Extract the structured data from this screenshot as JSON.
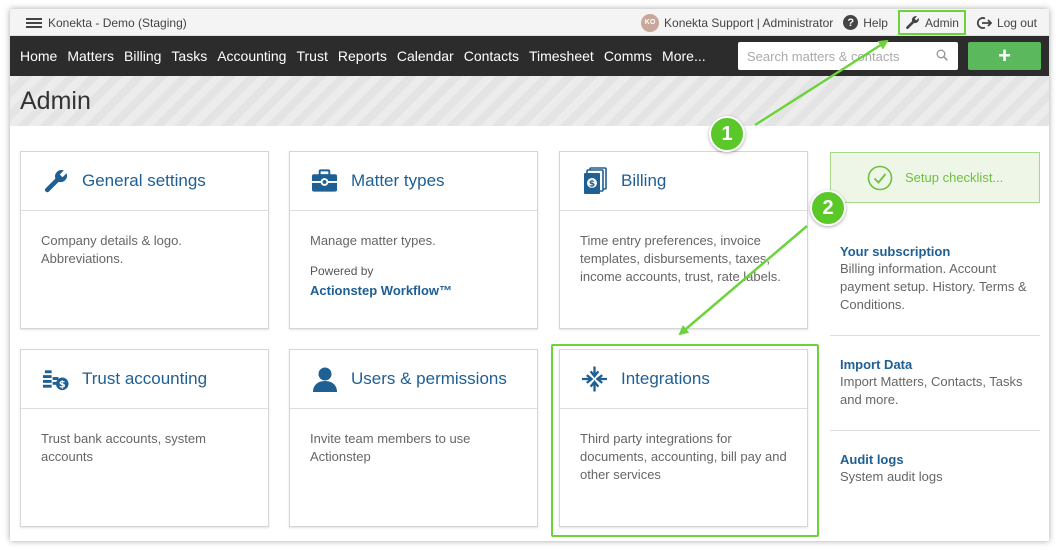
{
  "topbar": {
    "app_title": "Konekta - Demo (Staging)",
    "avatar_initials": "KO",
    "user": "Konekta Support | Administrator",
    "help": "Help",
    "admin": "Admin",
    "logout": "Log out"
  },
  "nav": {
    "items": [
      "Home",
      "Matters",
      "Billing",
      "Tasks",
      "Accounting",
      "Trust",
      "Reports",
      "Calendar",
      "Contacts",
      "Timesheet",
      "Comms",
      "More..."
    ],
    "search_placeholder": "Search matters & contacts",
    "add_label": "+"
  },
  "page": {
    "title": "Admin"
  },
  "cards": [
    {
      "title": "General settings",
      "desc": "Company details & logo. Abbreviations.",
      "icon": "wrench-icon"
    },
    {
      "title": "Matter types",
      "desc": "Manage matter types.",
      "powered_by": "Powered by",
      "powered_link": "Actionstep Workflow™",
      "icon": "toolbox-icon"
    },
    {
      "title": "Billing",
      "desc": "Time entry preferences, invoice templates, disbursements, taxes, income accounts, trust, rate labels.",
      "icon": "invoice-icon"
    },
    {
      "title": "Trust accounting",
      "desc": "Trust bank accounts, system accounts",
      "icon": "coins-icon"
    },
    {
      "title": "Users & permissions",
      "desc": "Invite team members to use Actionstep",
      "icon": "user-icon"
    },
    {
      "title": "Integrations",
      "desc": "Third party integrations for documents, accounting, bill pay and other services",
      "icon": "integrations-icon"
    }
  ],
  "sidebar": {
    "setup_checklist": "Setup checklist...",
    "links": [
      {
        "title": "Your subscription",
        "desc": "Billing information. Account payment setup. History. Terms & Conditions."
      },
      {
        "title": "Import Data",
        "desc": "Import Matters, Contacts, Tasks and more."
      },
      {
        "title": "Audit logs",
        "desc": "System audit logs"
      }
    ]
  },
  "annotations": {
    "step1": "1",
    "step2": "2"
  },
  "colors": {
    "brand_blue": "#1e5f94",
    "highlight_green": "#6dd33a",
    "nav_bg": "#2c2c2c",
    "add_button": "#5cb85c"
  }
}
